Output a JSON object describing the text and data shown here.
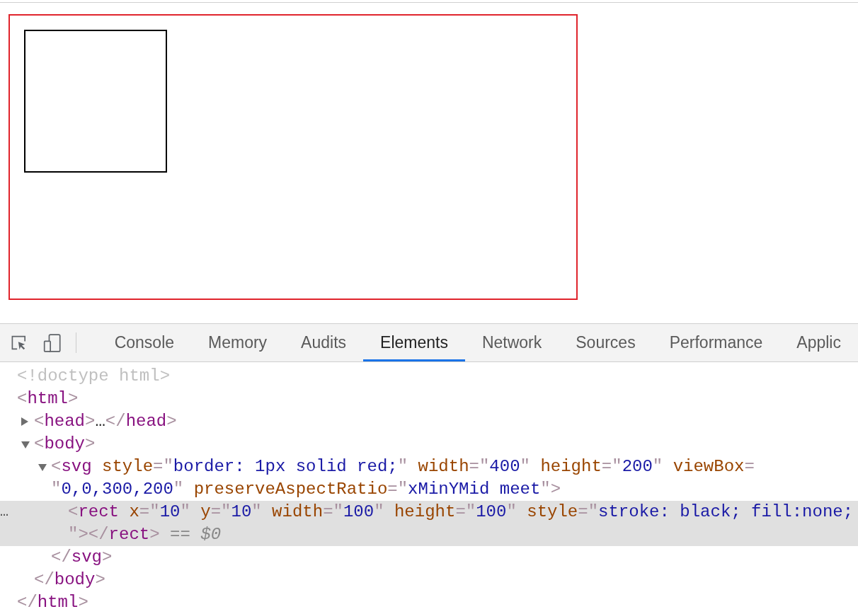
{
  "devtools": {
    "toolbar": {
      "tools": [
        {
          "kind": "inspect"
        },
        {
          "kind": "device"
        }
      ]
    },
    "tabs": [
      {
        "label": "Console",
        "selected": false
      },
      {
        "label": "Memory",
        "selected": false
      },
      {
        "label": "Audits",
        "selected": false
      },
      {
        "label": "Elements",
        "selected": true
      },
      {
        "label": "Network",
        "selected": false
      },
      {
        "label": "Sources",
        "selected": false
      },
      {
        "label": "Performance",
        "selected": false
      },
      {
        "label": "Applic",
        "selected": false
      }
    ],
    "dom_tree": [
      {
        "selected": false,
        "lines": [
          [
            {
              "kind": "doctype",
              "text": "<!doctype html>"
            }
          ]
        ]
      },
      {
        "selected": false,
        "lines": [
          [
            {
              "kind": "punct",
              "text": "<"
            },
            {
              "kind": "tag",
              "text": "html"
            },
            {
              "kind": "punct",
              "text": ">"
            }
          ]
        ],
        "closing": [
          {
            "kind": "punct",
            "text": "</"
          },
          {
            "kind": "tag",
            "text": "html"
          },
          {
            "kind": "punct",
            "text": ">"
          }
        ],
        "children": [
          {
            "selected": false,
            "expanded": false,
            "lines": [
              [
                {
                  "kind": "punct",
                  "text": "<"
                },
                {
                  "kind": "tag",
                  "text": "head"
                },
                {
                  "kind": "punct",
                  "text": ">"
                },
                {
                  "kind": "ellipsis",
                  "text": "…"
                },
                {
                  "kind": "punct",
                  "text": "</"
                },
                {
                  "kind": "tag",
                  "text": "head"
                },
                {
                  "kind": "punct",
                  "text": ">"
                }
              ]
            ]
          },
          {
            "selected": false,
            "expanded": true,
            "lines": [
              [
                {
                  "kind": "punct",
                  "text": "<"
                },
                {
                  "kind": "tag",
                  "text": "body"
                },
                {
                  "kind": "punct",
                  "text": ">"
                }
              ]
            ],
            "closing": [
              {
                "kind": "punct",
                "text": "</"
              },
              {
                "kind": "tag",
                "text": "body"
              },
              {
                "kind": "punct",
                "text": ">"
              }
            ],
            "children": [
              {
                "selected": false,
                "expanded": true,
                "lines": [
                  [
                    {
                      "kind": "punct",
                      "text": "<"
                    },
                    {
                      "kind": "tag",
                      "text": "svg"
                    },
                    {
                      "kind": "attr",
                      "text": " style"
                    },
                    {
                      "kind": "punct",
                      "text": "=\""
                    },
                    {
                      "kind": "value",
                      "text": "border: 1px solid red;"
                    },
                    {
                      "kind": "punct",
                      "text": "\""
                    },
                    {
                      "kind": "attr",
                      "text": " width"
                    },
                    {
                      "kind": "punct",
                      "text": "=\""
                    },
                    {
                      "kind": "value",
                      "text": "400"
                    },
                    {
                      "kind": "punct",
                      "text": "\""
                    },
                    {
                      "kind": "attr",
                      "text": " height"
                    },
                    {
                      "kind": "punct",
                      "text": "=\""
                    },
                    {
                      "kind": "value",
                      "text": "200"
                    },
                    {
                      "kind": "punct",
                      "text": "\""
                    },
                    {
                      "kind": "attr",
                      "text": " viewBox"
                    },
                    {
                      "kind": "punct",
                      "text": "="
                    }
                  ],
                  [
                    {
                      "kind": "punct",
                      "text": "\""
                    },
                    {
                      "kind": "value",
                      "text": "0,0,300,200"
                    },
                    {
                      "kind": "punct",
                      "text": "\""
                    },
                    {
                      "kind": "attr",
                      "text": " preserveAspectRatio"
                    },
                    {
                      "kind": "punct",
                      "text": "=\""
                    },
                    {
                      "kind": "value",
                      "text": "xMinYMid meet"
                    },
                    {
                      "kind": "punct",
                      "text": "\">"
                    }
                  ]
                ],
                "closing": [
                  {
                    "kind": "punct",
                    "text": "</"
                  },
                  {
                    "kind": "tag",
                    "text": "svg"
                  },
                  {
                    "kind": "punct",
                    "text": ">"
                  }
                ],
                "children": [
                  {
                    "selected": true,
                    "marker": "…",
                    "lines": [
                      [
                        {
                          "kind": "punct",
                          "text": "<"
                        },
                        {
                          "kind": "tag",
                          "text": "rect"
                        },
                        {
                          "kind": "attr",
                          "text": " x"
                        },
                        {
                          "kind": "punct",
                          "text": "=\""
                        },
                        {
                          "kind": "value",
                          "text": "10"
                        },
                        {
                          "kind": "punct",
                          "text": "\""
                        },
                        {
                          "kind": "attr",
                          "text": " y"
                        },
                        {
                          "kind": "punct",
                          "text": "=\""
                        },
                        {
                          "kind": "value",
                          "text": "10"
                        },
                        {
                          "kind": "punct",
                          "text": "\""
                        },
                        {
                          "kind": "attr",
                          "text": " width"
                        },
                        {
                          "kind": "punct",
                          "text": "=\""
                        },
                        {
                          "kind": "value",
                          "text": "100"
                        },
                        {
                          "kind": "punct",
                          "text": "\""
                        },
                        {
                          "kind": "attr",
                          "text": " height"
                        },
                        {
                          "kind": "punct",
                          "text": "=\""
                        },
                        {
                          "kind": "value",
                          "text": "100"
                        },
                        {
                          "kind": "punct",
                          "text": "\""
                        },
                        {
                          "kind": "attr",
                          "text": " style"
                        },
                        {
                          "kind": "punct",
                          "text": "=\""
                        },
                        {
                          "kind": "value",
                          "text": "stroke: black; fill:none;"
                        }
                      ],
                      [
                        {
                          "kind": "punct",
                          "text": "\"></"
                        },
                        {
                          "kind": "tag",
                          "text": "rect"
                        },
                        {
                          "kind": "punct",
                          "text": ">"
                        },
                        {
                          "kind": "note",
                          "text": " == "
                        },
                        {
                          "kind": "var",
                          "text": "$0"
                        }
                      ]
                    ]
                  }
                ]
              }
            ]
          }
        ]
      }
    ]
  }
}
